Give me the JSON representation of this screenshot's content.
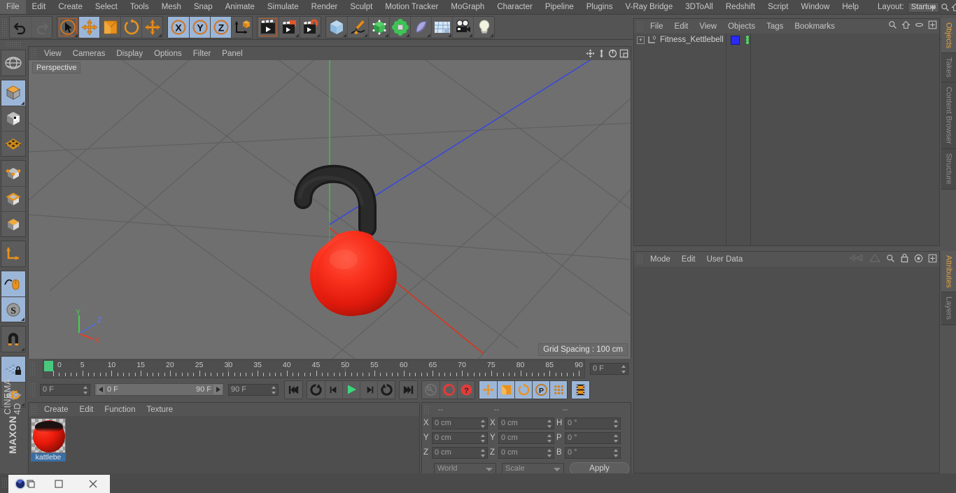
{
  "app": {
    "title": "MAXON CINEMA 4D",
    "brand_line1": "MAXON",
    "brand_line2": "CINEMA 4D"
  },
  "menubar": {
    "items": [
      {
        "label": "File"
      },
      {
        "label": "Edit"
      },
      {
        "label": "Create"
      },
      {
        "label": "Select"
      },
      {
        "label": "Tools"
      },
      {
        "label": "Mesh"
      },
      {
        "label": "Snap"
      },
      {
        "label": "Animate"
      },
      {
        "label": "Simulate"
      },
      {
        "label": "Render"
      },
      {
        "label": "Sculpt"
      },
      {
        "label": "Motion Tracker"
      },
      {
        "label": "MoGraph"
      },
      {
        "label": "Character"
      },
      {
        "label": "Pipeline"
      },
      {
        "label": "Plugins"
      },
      {
        "label": "V-Ray Bridge"
      },
      {
        "label": "3DToAll"
      },
      {
        "label": "Redshift"
      },
      {
        "label": "Script"
      },
      {
        "label": "Window"
      },
      {
        "label": "Help"
      }
    ],
    "layout_label": "Layout:",
    "layout_value": "Startup",
    "search_icon": "search-icon"
  },
  "toolbar_top": {
    "groups": [
      {
        "buttons": [
          {
            "name": "undo-button",
            "icon": "undo-arrow-icon",
            "state": "normal"
          },
          {
            "name": "redo-button",
            "icon": "redo-arrow-icon",
            "state": "dim"
          }
        ]
      },
      {
        "buttons": [
          {
            "name": "live-selection-tool",
            "icon": "cursor-circle-icon",
            "state": "selected"
          },
          {
            "name": "move-tool",
            "icon": "move-arrows-icon",
            "state": "active"
          },
          {
            "name": "scale-tool",
            "icon": "scale-box-icon",
            "state": "normal"
          },
          {
            "name": "rotate-tool",
            "icon": "rotate-circle-icon",
            "state": "normal"
          },
          {
            "name": "pan-tool",
            "icon": "move-arrows-icon",
            "state": "normal"
          }
        ]
      },
      {
        "buttons": [
          {
            "name": "axis-x-toggle",
            "icon": "x-axis-icon",
            "state": "active",
            "label": "X"
          },
          {
            "name": "axis-y-toggle",
            "icon": "y-axis-icon",
            "state": "active",
            "label": "Y"
          },
          {
            "name": "axis-z-toggle",
            "icon": "z-axis-icon",
            "state": "active",
            "label": "Z"
          },
          {
            "name": "world-object-axis-toggle",
            "icon": "world-axis-cube-icon",
            "state": "normal"
          }
        ]
      },
      {
        "buttons": [
          {
            "name": "render-view-button",
            "icon": "clapperboard-icon",
            "state": "selected"
          },
          {
            "name": "render-region-button",
            "icon": "clapperboard-region-icon",
            "state": "normal"
          },
          {
            "name": "render-settings-button",
            "icon": "clapperboard-gear-icon",
            "state": "normal"
          }
        ]
      },
      {
        "buttons": [
          {
            "name": "add-cube-button",
            "icon": "blue-cube-icon",
            "state": "normal"
          },
          {
            "name": "add-spline-button",
            "icon": "pen-spline-icon",
            "state": "normal"
          },
          {
            "name": "add-generator-button",
            "icon": "green-cube-icon",
            "state": "normal"
          },
          {
            "name": "add-mograph-button",
            "icon": "cloner-icon",
            "state": "normal"
          },
          {
            "name": "add-deformer-button",
            "icon": "bend-deformer-icon",
            "state": "normal"
          },
          {
            "name": "add-environment-button",
            "icon": "floor-grid-icon",
            "state": "normal"
          },
          {
            "name": "add-camera-button",
            "icon": "camera-icon",
            "state": "normal"
          },
          {
            "name": "add-light-button",
            "icon": "light-bulb-icon",
            "state": "normal"
          }
        ]
      }
    ]
  },
  "toolbar_left": {
    "groups": [
      {
        "buttons": [
          {
            "name": "undo-view-button",
            "icon": "globe-wire-icon",
            "state": "normal"
          }
        ]
      },
      {
        "buttons": [
          {
            "name": "make-editable-button",
            "icon": "editable-cube-icon",
            "state": "active"
          },
          {
            "name": "model-mode-button",
            "icon": "checker-cube-icon",
            "state": "normal"
          },
          {
            "name": "texture-mode-button",
            "icon": "texture-grid-icon",
            "state": "normal"
          }
        ]
      },
      {
        "buttons": [
          {
            "name": "points-mode-button",
            "icon": "points-cube-icon",
            "state": "normal"
          },
          {
            "name": "edges-mode-button",
            "icon": "edges-cube-icon",
            "state": "normal"
          },
          {
            "name": "polygons-mode-button",
            "icon": "polygons-cube-icon",
            "state": "normal"
          }
        ]
      },
      {
        "buttons": [
          {
            "name": "axis-modify-button",
            "icon": "axis-l-icon",
            "state": "normal"
          }
        ]
      },
      {
        "buttons": [
          {
            "name": "enable-snapping-button",
            "icon": "mouse-snap-icon",
            "state": "active"
          },
          {
            "name": "soft-selection-button",
            "icon": "s-sphere-icon",
            "state": "active"
          }
        ]
      },
      {
        "buttons": [
          {
            "name": "magnet-tool-button",
            "icon": "magnet-icon",
            "state": "normal"
          }
        ]
      },
      {
        "buttons": [
          {
            "name": "lock-workplane-button",
            "icon": "grid-lock-icon",
            "state": "active"
          },
          {
            "name": "workplane-rotate-button",
            "icon": "grid-rotate-icon",
            "state": "normal"
          }
        ]
      }
    ]
  },
  "viewport": {
    "menus": [
      "View",
      "Cameras",
      "Display",
      "Options",
      "Filter",
      "Panel"
    ],
    "label": "Perspective",
    "grid_info": "Grid Spacing : 100 cm",
    "controls": [
      {
        "name": "viewport-pan-icon",
        "icon": "pan-4arrow-icon"
      },
      {
        "name": "viewport-dolly-icon",
        "icon": "updown-arrow-icon"
      },
      {
        "name": "viewport-rotate-icon",
        "icon": "orbit-icon"
      },
      {
        "name": "viewport-maximize-icon",
        "icon": "maximize-icon"
      }
    ],
    "axes": [
      {
        "label": "Y",
        "color": "#3bd14a"
      },
      {
        "label": "Z",
        "color": "#4a6cf0"
      },
      {
        "label": "X",
        "color": "#e0402c"
      }
    ],
    "scene": {
      "object_name": "Fitness_Kettlebell",
      "body_color": "#f02418",
      "handle_color": "#181818"
    }
  },
  "timeline": {
    "tick_labels": [
      "0",
      "5",
      "10",
      "15",
      "20",
      "25",
      "30",
      "35",
      "40",
      "45",
      "50",
      "55",
      "60",
      "65",
      "70",
      "75",
      "80",
      "85",
      "90"
    ],
    "current_frame_field": "0 F",
    "range_start_field": "0 F",
    "range_slider_start": "0 F",
    "range_slider_end": "90 F",
    "range_end_field": "90 F"
  },
  "playback": {
    "buttons": [
      {
        "name": "go-to-start-button",
        "icon": "skip-start-icon",
        "state": "normal"
      },
      {
        "name": "go-back-keyframe-button",
        "icon": "rewind-key-icon",
        "state": "normal"
      },
      {
        "name": "step-back-button",
        "icon": "step-back-icon",
        "state": "normal"
      },
      {
        "name": "play-button",
        "icon": "play-icon",
        "state": "normal"
      },
      {
        "name": "step-forward-button",
        "icon": "step-forward-icon",
        "state": "normal"
      },
      {
        "name": "forward-keyframe-button",
        "icon": "forward-key-icon",
        "state": "normal"
      },
      {
        "name": "go-to-end-button",
        "icon": "skip-end-icon",
        "state": "normal"
      },
      {
        "name": "record-active-objects-button",
        "icon": "key-icon",
        "state": "dim"
      },
      {
        "name": "autokeying-button",
        "icon": "red-circle-icon",
        "state": "normal"
      },
      {
        "name": "keyframe-selection-button",
        "icon": "red-question-icon",
        "state": "normal"
      },
      {
        "name": "record-position-button",
        "icon": "move-arrows-icon",
        "state": "active"
      },
      {
        "name": "record-scale-button",
        "icon": "scale-box-icon",
        "state": "active"
      },
      {
        "name": "record-rotation-button",
        "icon": "rotate-circle-icon",
        "state": "active"
      },
      {
        "name": "record-param-button",
        "icon": "p-circle-icon",
        "state": "active"
      },
      {
        "name": "record-pla-button",
        "icon": "point-grid-icon",
        "state": "active"
      },
      {
        "name": "timeline-mode-button",
        "icon": "filmstrip-icon",
        "state": "active"
      }
    ]
  },
  "material_manager": {
    "menus": [
      "Create",
      "Edit",
      "Function",
      "Texture"
    ],
    "materials": [
      {
        "name": "kattlebe",
        "color": "#f02418"
      }
    ]
  },
  "coordinates": {
    "headers": [
      "--",
      "--",
      "--"
    ],
    "position_labels": [
      "X",
      "Y",
      "Z"
    ],
    "size_labels": [
      "X",
      "Y",
      "Z"
    ],
    "rotation_labels": [
      "H",
      "P",
      "B"
    ],
    "position_values": [
      "0 cm",
      "0 cm",
      "0 cm"
    ],
    "size_values": [
      "0 cm",
      "0 cm",
      "0 cm"
    ],
    "rotation_values": [
      "0 °",
      "0 °",
      "0 °"
    ],
    "coord_system": "World",
    "scale_mode": "Scale",
    "apply_label": "Apply"
  },
  "object_manager": {
    "menus": [
      "File",
      "Edit",
      "View",
      "Objects",
      "Tags",
      "Bookmarks"
    ],
    "icons": [
      {
        "name": "search-icon"
      },
      {
        "name": "home-icon"
      },
      {
        "name": "ellipse-icon"
      },
      {
        "name": "add-panel-icon"
      }
    ],
    "rows": [
      {
        "name": "Fitness_Kettlebell",
        "expand": "+",
        "layer_number": "0",
        "tag_color": "#2a2af0"
      }
    ]
  },
  "attribute_manager": {
    "menus": [
      "Mode",
      "Edit",
      "User Data"
    ],
    "icons": [
      {
        "name": "back-nav-icon"
      },
      {
        "name": "forward-nav-icon"
      },
      {
        "name": "search-icon"
      },
      {
        "name": "lock-icon"
      },
      {
        "name": "target-icon"
      },
      {
        "name": "add-panel-icon"
      }
    ]
  },
  "vertical_tabs": {
    "top": [
      {
        "label": "Objects",
        "active": true
      },
      {
        "label": "Takes",
        "active": false
      },
      {
        "label": "Content Browser",
        "active": false
      },
      {
        "label": "Structure",
        "active": false
      }
    ],
    "bottom": [
      {
        "label": "Attributes",
        "active": true
      },
      {
        "label": "Layers",
        "active": false
      }
    ]
  },
  "taskbar": {
    "buttons": [
      {
        "name": "c4d-app-icon",
        "label": ""
      },
      {
        "name": "restore-window-button",
        "label": ""
      },
      {
        "name": "close-window-button",
        "label": "×"
      }
    ]
  },
  "colors": {
    "accent_orange": "#e8a33d",
    "active_blue": "#9cb6d8",
    "panel_bg": "#545454",
    "viewport_bg": "#6f6f6f"
  }
}
